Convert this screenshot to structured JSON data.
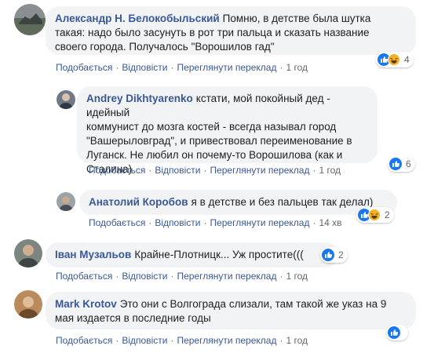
{
  "comments": [
    {
      "author": "Александр Н. Белокобыльский",
      "text_lines": [
        "Помню, в детстве была шутка",
        "такая: надо было засунуть в рот три пальца и сказать название",
        "своего города. Получалось \"Ворошилов гад\""
      ],
      "like": "Подобається",
      "reply": "Відповісти",
      "translate": "Переглянути переклад",
      "time": "1 год",
      "reaction_count": "4",
      "reaction_icons": [
        "like-icon",
        "haha-icon"
      ]
    },
    {
      "author": "Andrey Dikhtyarenko",
      "text_lines": [
        "кстати, мой покойный дед - идейный",
        "коммунист до мозга костей - всегда называл город",
        "\"Вашерыловград\", и привествовал переименование в",
        "Луганск. Не любил он почему-то Ворошилова (как и",
        "Сталина)"
      ],
      "like": "Подобається",
      "reply": "Відповісти",
      "translate": "Переглянути переклад",
      "time": "1 год",
      "reaction_count": "6",
      "reaction_icons": [
        "like-icon"
      ]
    },
    {
      "author": "Анатолий Коробов",
      "text_lines": [
        "я в детстве и без пальцев так делал)"
      ],
      "like": "Подобається",
      "reply": "Відповісти",
      "translate": "Переглянути переклад",
      "time": "14 хв",
      "reaction_count": "2",
      "reaction_icons": [
        "like-icon",
        "haha-icon"
      ]
    },
    {
      "author": "Іван Музальов",
      "text_lines": [
        "Крайне-Плотницк... Уж простите((("
      ],
      "like": "Подобається",
      "reply": "Відповісти",
      "translate": "Переглянути переклад",
      "time": "1 год",
      "reaction_count": "2",
      "reaction_icons": [
        "like-icon"
      ]
    },
    {
      "author": "Mark Krotov",
      "text_lines": [
        "Это они с Волгограда слизали, там такой же указ на 9",
        "мая издается в последние годы"
      ],
      "like": "Подобається",
      "reply": "Відповісти",
      "translate": "Переглянути переклад",
      "time": "1 год",
      "reaction_count": "",
      "reaction_icons": [
        "like-icon"
      ]
    }
  ],
  "colors": {
    "link": "#385898",
    "bubble": "#f2f3f5",
    "like": "#1877f2",
    "haha": "#f7b125"
  }
}
